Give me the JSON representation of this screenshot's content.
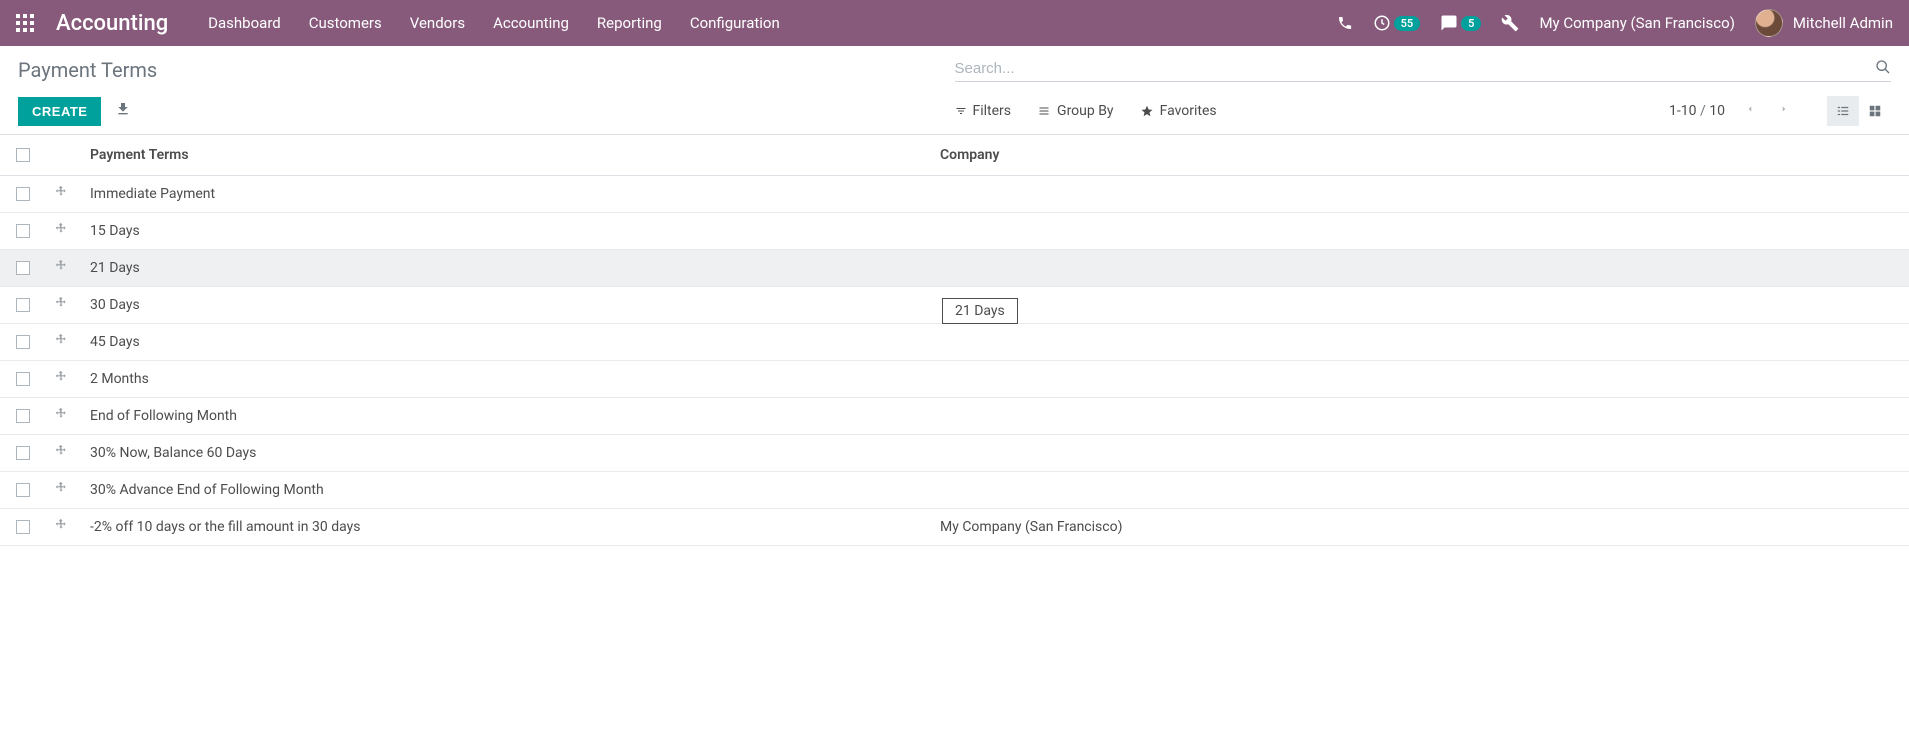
{
  "nav": {
    "brand": "Accounting",
    "menu": [
      "Dashboard",
      "Customers",
      "Vendors",
      "Accounting",
      "Reporting",
      "Configuration"
    ],
    "activity_badge": "55",
    "messages_badge": "5",
    "company": "My Company (San Francisco)",
    "user": "Mitchell Admin"
  },
  "breadcrumb": "Payment Terms",
  "search": {
    "placeholder": "Search..."
  },
  "toolbar": {
    "create_label": "CREATE",
    "filters_label": "Filters",
    "groupby_label": "Group By",
    "favorites_label": "Favorites"
  },
  "pager": {
    "range": "1-10",
    "sep": "/",
    "total": "10"
  },
  "columns": {
    "name": "Payment Terms",
    "company": "Company"
  },
  "rows": [
    {
      "name": "Immediate Payment",
      "company": ""
    },
    {
      "name": "15 Days",
      "company": ""
    },
    {
      "name": "21 Days",
      "company": ""
    },
    {
      "name": "30 Days",
      "company": ""
    },
    {
      "name": "45 Days",
      "company": ""
    },
    {
      "name": "2 Months",
      "company": ""
    },
    {
      "name": "End of Following Month",
      "company": ""
    },
    {
      "name": "30% Now, Balance 60 Days",
      "company": ""
    },
    {
      "name": "30% Advance End of Following Month",
      "company": ""
    },
    {
      "name": "-2% off 10 days or the fill amount in 30 days",
      "company": "My Company (San Francisco)"
    }
  ],
  "hovered_row_index": 2,
  "tooltip_text": "21 Days"
}
